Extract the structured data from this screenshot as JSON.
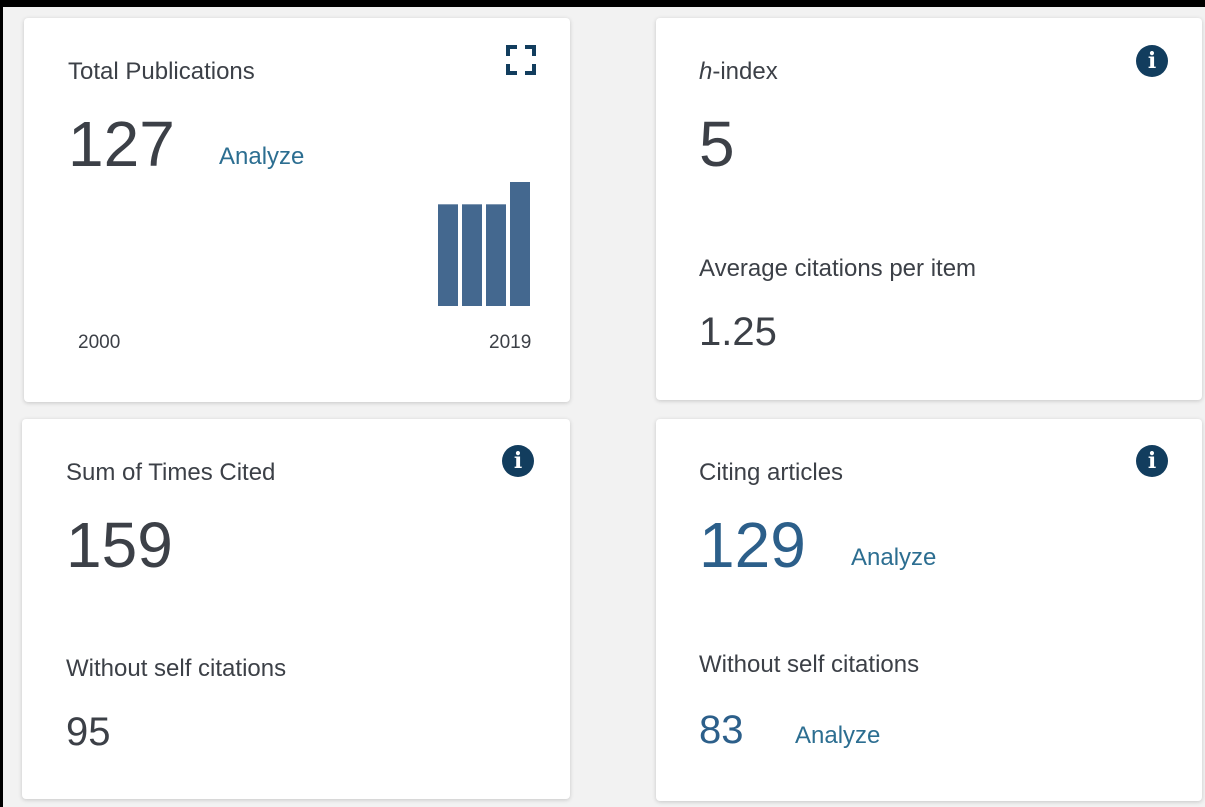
{
  "cards": {
    "total_publications": {
      "label": "Total Publications",
      "value": "127",
      "analyze_label": "Analyze",
      "chart_start_label": "2000",
      "chart_end_label": "2019"
    },
    "h_index": {
      "label_italic": "h",
      "label_rest": "-index",
      "value": "5",
      "avg_label": "Average citations per item",
      "avg_value": "1.25"
    },
    "sum_times_cited": {
      "label": "Sum of Times Cited",
      "value": "159",
      "without_self_label": "Without self citations",
      "without_self_value": "95"
    },
    "citing_articles": {
      "label": "Citing articles",
      "value": "129",
      "analyze_label": "Analyze",
      "without_self_label": "Without self citations",
      "without_self_value": "83",
      "without_self_analyze_label": "Analyze"
    }
  },
  "icons": {
    "info": "info-icon",
    "expand": "expand-icon"
  },
  "colors": {
    "accent_link": "#2c6e91",
    "bar": "#44688f",
    "info_icon": "#123d5e",
    "number_link": "#2c5f8a"
  },
  "chart_data": {
    "type": "bar",
    "xlabel": "",
    "ylabel": "",
    "x_range": [
      "2000",
      "2019"
    ],
    "values": [
      0.82,
      0.82,
      0.82,
      1.0
    ]
  }
}
